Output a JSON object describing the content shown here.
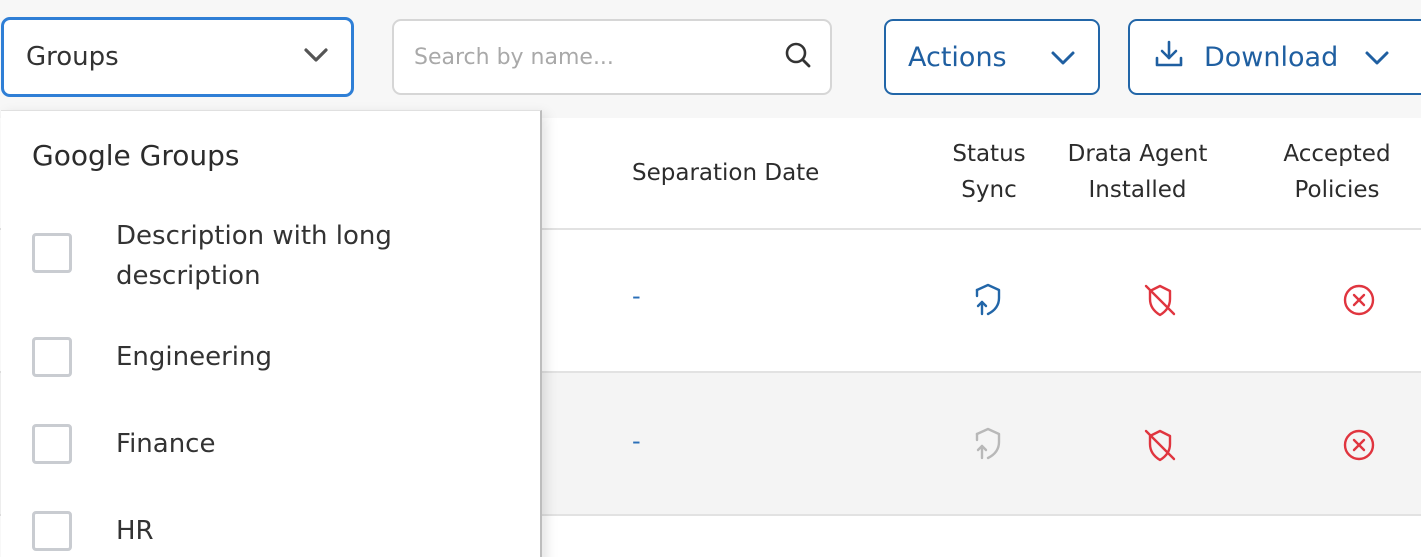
{
  "toolbar": {
    "groups_label": "Groups",
    "search_placeholder": "Search by name...",
    "actions_label": "Actions",
    "download_label": "Download"
  },
  "table": {
    "headers": {
      "separation_date": "Separation Date",
      "status_sync_1": "Status",
      "status_sync_2": "Sync",
      "agent_1": "Drata Agent",
      "agent_2": "Installed",
      "policies_1": "Accepted",
      "policies_2": "Policies"
    },
    "rows": [
      {
        "separation_date": "-",
        "status_sync_icon": "shield-sync-icon",
        "status_sync_color": "#2266a8",
        "agent_icon": "shield-off-icon",
        "policies_icon": "x-circle-icon"
      },
      {
        "separation_date": "-",
        "status_sync_icon": "shield-sync-icon",
        "status_sync_color": "#b8b8b8",
        "agent_icon": "shield-off-icon",
        "policies_icon": "x-circle-icon"
      }
    ]
  },
  "dropdown": {
    "title": "Google Groups",
    "options": [
      {
        "label": "Description with long description",
        "checked": false
      },
      {
        "label": "Engineering",
        "checked": false
      },
      {
        "label": "Finance",
        "checked": false
      },
      {
        "label": "HR",
        "checked": false
      }
    ]
  },
  "colors": {
    "accent": "#2266a8",
    "focus_border": "#2f7fd6",
    "error": "#e0353f"
  }
}
